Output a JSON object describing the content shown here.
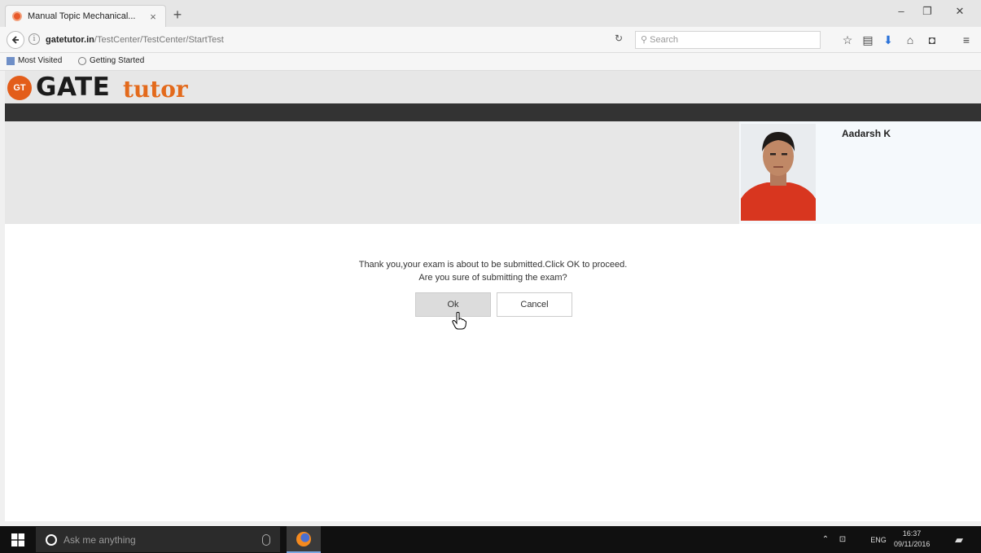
{
  "browser": {
    "tab_title": "Manual Topic Mechanical...",
    "tab_close": "×",
    "new_tab": "+",
    "window_controls": {
      "minimize": "–",
      "restore": "❐",
      "close": "✕"
    },
    "url_host": "gatetutor.in",
    "url_path": "/TestCenter/TestCenter/StartTest",
    "search_placeholder": "Search",
    "toolbar_icons": [
      "star-icon",
      "reading-list-icon",
      "download-icon",
      "home-icon",
      "pocket-icon",
      "menu-icon"
    ],
    "bookmarks": [
      {
        "label": "Most Visited"
      },
      {
        "label": "Getting Started"
      }
    ]
  },
  "site": {
    "logo_badge": "GT",
    "logo_main": "GATE",
    "logo_accent": "tutor",
    "colors": {
      "accent": "#e36a1c",
      "dark_bar": "#333333"
    }
  },
  "user": {
    "name": "Aadarsh K"
  },
  "dialog": {
    "line1": "Thank you,your exam is about to be submitted.Click OK to proceed.",
    "line2": "Are you sure of submitting the exam?",
    "ok_label": "Ok",
    "cancel_label": "Cancel"
  },
  "taskbar": {
    "search_placeholder": "Ask me anything",
    "language": "ENG",
    "time": "16:37",
    "date": "09/11/2016"
  }
}
